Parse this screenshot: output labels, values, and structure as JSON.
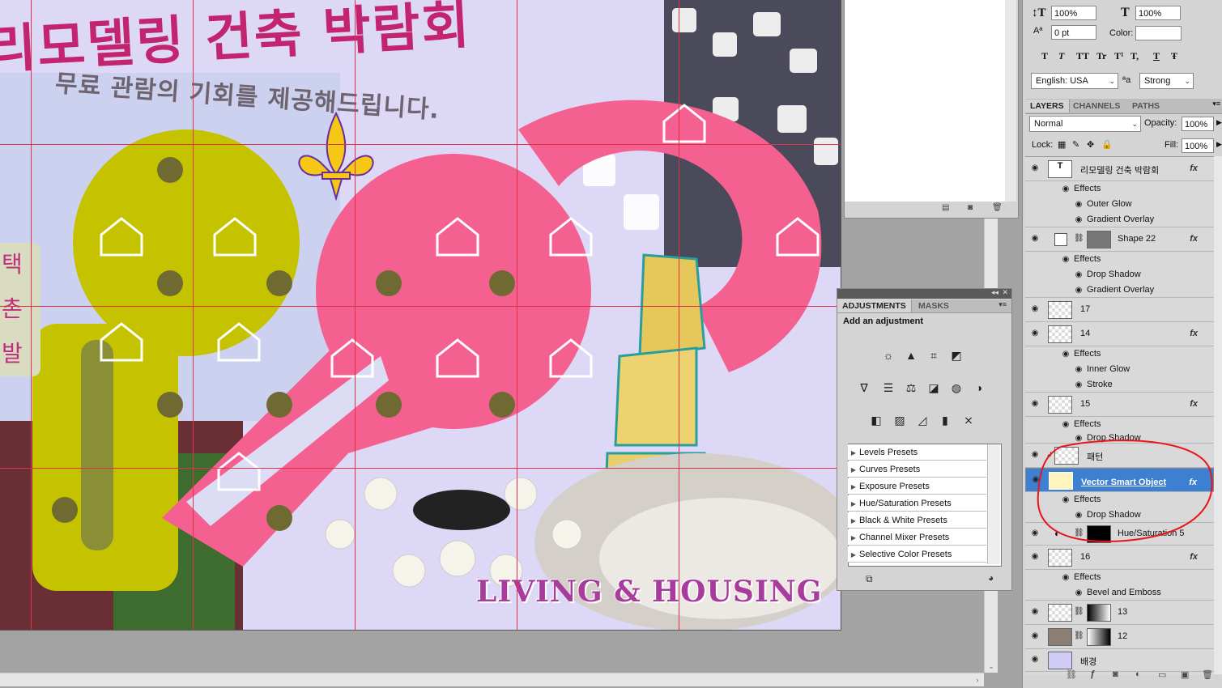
{
  "canvas": {
    "title_korean": "리모델링 건축 박람회",
    "subtitle_korean": "무료 관람의 기회를 제공해드립니다.",
    "side_text": [
      "택",
      "촌",
      "발"
    ],
    "brand_text": "LIVING & HOUSING"
  },
  "character_panel": {
    "vertical_scale": "100%",
    "horizontal_scale": "100%",
    "baseline_shift": "0 pt",
    "color_label": "Color:",
    "style_buttons": [
      "T",
      "T",
      "TT",
      "Tr",
      "T¹",
      "T,",
      "T",
      "Ŧ"
    ],
    "language": "English: USA",
    "aa_label": "ªa",
    "antialias": "Strong"
  },
  "layers_panel": {
    "tabs": [
      "LAYERS",
      "CHANNELS",
      "PATHS"
    ],
    "blend_mode": "Normal",
    "opacity_label": "Opacity:",
    "opacity": "100%",
    "lock_label": "Lock:",
    "fill_label": "Fill:",
    "fill": "100%",
    "rows": [
      {
        "type": "layer",
        "name": "리모델링 건축 박람회",
        "fx": "fx",
        "thumb": "T"
      },
      {
        "type": "sub",
        "name": "Effects"
      },
      {
        "type": "effect",
        "name": "Outer Glow"
      },
      {
        "type": "effect",
        "name": "Gradient Overlay"
      },
      {
        "type": "layer",
        "name": "Shape 22",
        "fx": "fx"
      },
      {
        "type": "sub",
        "name": "Effects"
      },
      {
        "type": "effect",
        "name": "Drop Shadow"
      },
      {
        "type": "effect",
        "name": "Gradient Overlay"
      },
      {
        "type": "layer",
        "name": "17",
        "fx": ""
      },
      {
        "type": "layer",
        "name": "14",
        "fx": "fx"
      },
      {
        "type": "sub",
        "name": "Effects"
      },
      {
        "type": "effect",
        "name": "Inner Glow"
      },
      {
        "type": "effect",
        "name": "Stroke"
      },
      {
        "type": "layer",
        "name": "15",
        "fx": "fx"
      },
      {
        "type": "sub",
        "name": "Effects"
      },
      {
        "type": "effect",
        "name": "Drop Shadow"
      },
      {
        "type": "layer",
        "name": "패턴",
        "fx": ""
      },
      {
        "type": "layer",
        "name": "Vector Smart Object",
        "fx": "fx",
        "selected": true
      },
      {
        "type": "sub",
        "name": "Effects"
      },
      {
        "type": "effect",
        "name": "Drop Shadow"
      },
      {
        "type": "layer",
        "name": "Hue/Saturation 5",
        "fx": ""
      },
      {
        "type": "layer",
        "name": "16",
        "fx": "fx"
      },
      {
        "type": "sub",
        "name": "Effects"
      },
      {
        "type": "effect",
        "name": "Bevel and Emboss"
      },
      {
        "type": "layer",
        "name": "13",
        "fx": ""
      },
      {
        "type": "layer",
        "name": "12",
        "fx": ""
      },
      {
        "type": "layer",
        "name": "배경",
        "fx": ""
      }
    ]
  },
  "adjustments_panel": {
    "tabs": [
      "ADJUSTMENTS",
      "MASKS"
    ],
    "heading": "Add an adjustment",
    "presets": [
      "Levels Presets",
      "Curves Presets",
      "Exposure Presets",
      "Hue/Saturation Presets",
      "Black & White Presets",
      "Channel Mixer Presets",
      "Selective Color Presets"
    ],
    "icon_rows": [
      [
        "brightness-icon",
        "levels-icon",
        "curves-icon",
        "exposure-icon"
      ],
      [
        "vibrance-icon",
        "hue-saturation-icon",
        "color-balance-icon",
        "black-white-icon",
        "photo-filter-icon",
        "channel-mixer-icon"
      ],
      [
        "invert-icon",
        "posterize-icon",
        "threshold-icon",
        "gradient-map-icon",
        "selective-color-icon"
      ]
    ]
  },
  "colors": {
    "accent": "#3d7fd1",
    "annotation_red": "#e8151b",
    "pink_key": "#f4608f",
    "yellow_key": "#c5c300"
  }
}
